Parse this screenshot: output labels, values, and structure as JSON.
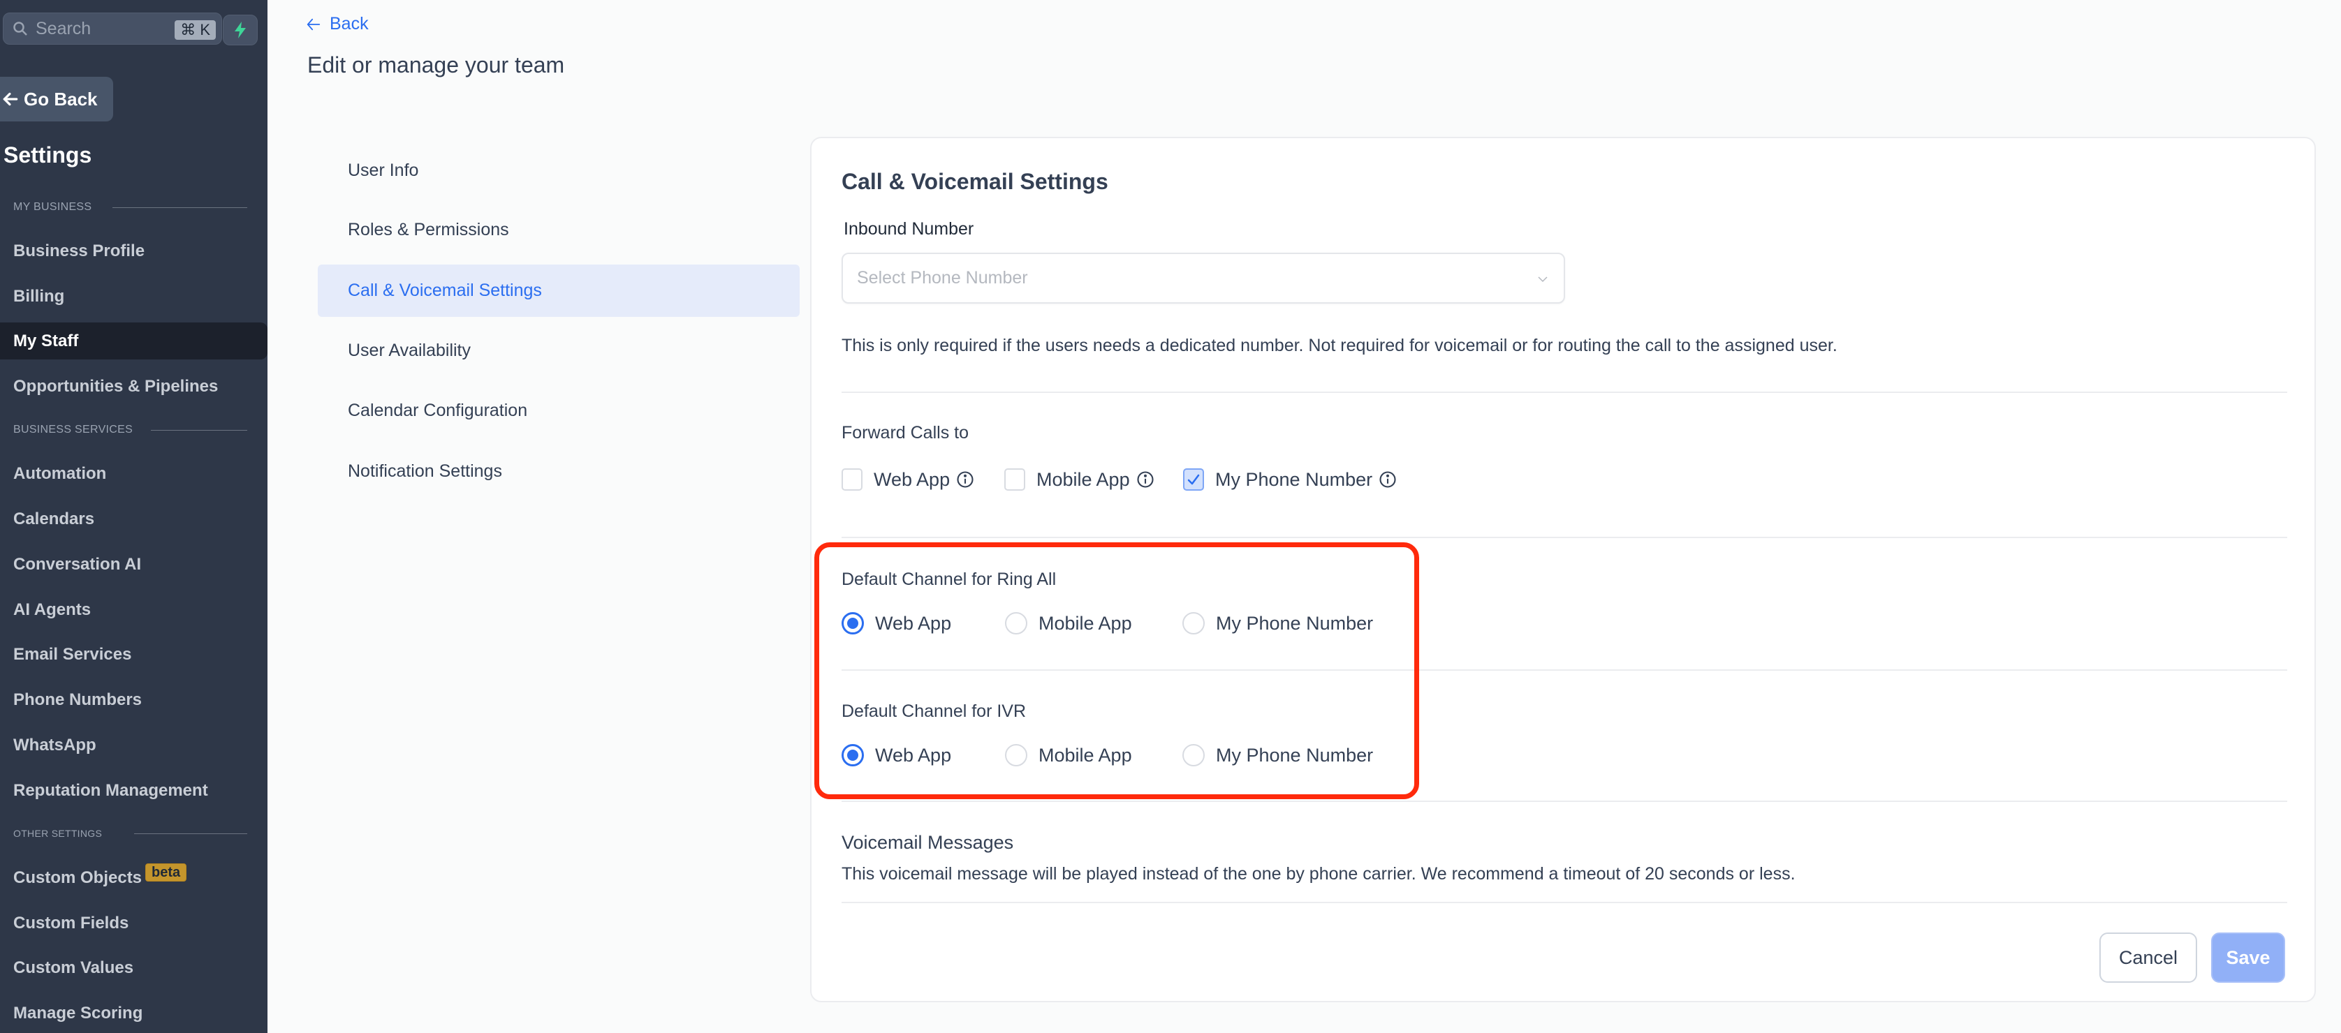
{
  "sidebar": {
    "search_placeholder": "Search",
    "search_shortcut": "⌘ K",
    "quick_action_icon": "lightning-bolt-icon",
    "go_back_label": "Go Back",
    "title": "Settings",
    "sections": [
      {
        "label": "MY BUSINESS",
        "items": [
          {
            "label": "Business Profile",
            "active": false
          },
          {
            "label": "Billing",
            "active": false
          },
          {
            "label": "My Staff",
            "active": true
          },
          {
            "label": "Opportunities & Pipelines",
            "active": false
          }
        ]
      },
      {
        "label": "BUSINESS SERVICES",
        "items": [
          {
            "label": "Automation",
            "active": false
          },
          {
            "label": "Calendars",
            "active": false
          },
          {
            "label": "Conversation AI",
            "active": false
          },
          {
            "label": "AI Agents",
            "active": false
          },
          {
            "label": "Email Services",
            "active": false
          },
          {
            "label": "Phone Numbers",
            "active": false
          },
          {
            "label": "WhatsApp",
            "active": false
          },
          {
            "label": "Reputation Management",
            "active": false
          }
        ]
      },
      {
        "label": "OTHER SETTINGS",
        "items": [
          {
            "label": "Custom Objects",
            "active": false,
            "badge": "beta"
          },
          {
            "label": "Custom Fields",
            "active": false
          },
          {
            "label": "Custom Values",
            "active": false
          },
          {
            "label": "Manage Scoring",
            "active": false
          }
        ]
      }
    ]
  },
  "header": {
    "back_label": "Back",
    "title": "Edit or manage your team"
  },
  "team_nav": {
    "items": [
      {
        "label": "User Info",
        "active": false
      },
      {
        "label": "Roles & Permissions",
        "active": false
      },
      {
        "label": "Call & Voicemail Settings",
        "active": true
      },
      {
        "label": "User Availability",
        "active": false
      },
      {
        "label": "Calendar Configuration",
        "active": false
      },
      {
        "label": "Notification Settings",
        "active": false
      }
    ]
  },
  "card": {
    "title": "Call & Voicemail Settings",
    "inbound_number": {
      "label": "Inbound Number",
      "placeholder": "Select Phone Number",
      "value": "",
      "help": "This is only required if the users needs a dedicated number. Not required for voicemail or for routing the call to the assigned user."
    },
    "forward_calls": {
      "label": "Forward Calls to",
      "options": [
        {
          "label": "Web App",
          "checked": false,
          "info": true
        },
        {
          "label": "Mobile App",
          "checked": false,
          "info": true
        },
        {
          "label": "My Phone Number",
          "checked": true,
          "info": true
        }
      ]
    },
    "ring_all": {
      "label": "Default Channel for Ring All",
      "options": [
        "Web App",
        "Mobile App",
        "My Phone Number"
      ],
      "selected": "Web App"
    },
    "ivr": {
      "label": "Default Channel for IVR",
      "options": [
        "Web App",
        "Mobile App",
        "My Phone Number"
      ],
      "selected": "Web App"
    },
    "voicemail": {
      "label": "Voicemail Messages",
      "help": "This voicemail message will be played instead of the one by phone carrier. We recommend a timeout of 20 seconds or less."
    },
    "actions": {
      "cancel_label": "Cancel",
      "save_label": "Save",
      "save_disabled": true
    }
  },
  "annotation": {
    "highlight_color": "#ff2a0c"
  },
  "colors": {
    "sidebar_bg": "#2e3748",
    "accent": "#2b6ef0",
    "active_nav_bg": "#e5ebfa",
    "beta_badge": "#c4952c",
    "bolt": "#3ed598"
  }
}
